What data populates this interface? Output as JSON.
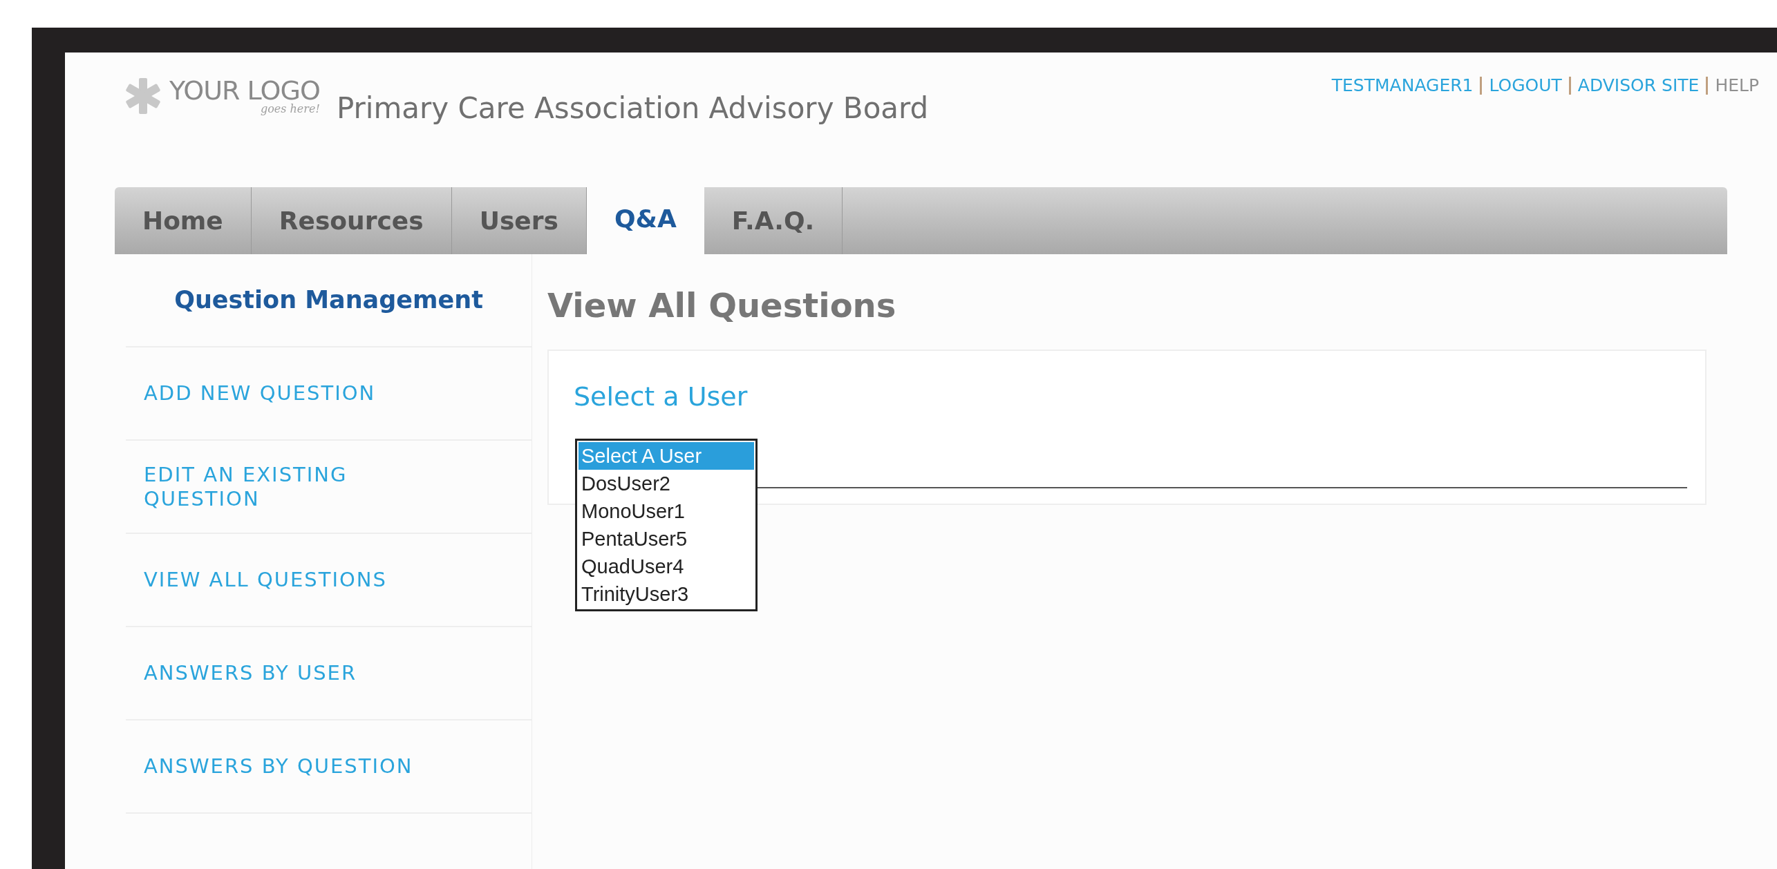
{
  "header": {
    "logo": {
      "main": "YOUR LOGO",
      "sub": "goes here!"
    },
    "site_title": "Primary Care Association Advisory Board",
    "top_links": [
      {
        "label": "TESTMANAGER1",
        "kind": "link"
      },
      {
        "label": "LOGOUT",
        "kind": "link"
      },
      {
        "label": "ADVISOR SITE",
        "kind": "link"
      },
      {
        "label": "HELP",
        "kind": "muted"
      }
    ]
  },
  "tabs": [
    {
      "label": "Home",
      "selected": false
    },
    {
      "label": "Resources",
      "selected": false
    },
    {
      "label": "Users",
      "selected": false
    },
    {
      "label": "Q&A",
      "selected": true
    },
    {
      "label": "F.A.Q.",
      "selected": false
    }
  ],
  "sidebar": {
    "title": "Question Management",
    "items": [
      "ADD NEW QUESTION",
      "EDIT AN EXISTING QUESTION",
      "VIEW ALL QUESTIONS",
      "ANSWERS BY USER",
      "ANSWERS BY QUESTION"
    ]
  },
  "main": {
    "heading": "View All Questions",
    "card_title": "Select a User",
    "user_list": [
      {
        "label": "Select A User",
        "selected": true
      },
      {
        "label": "DosUser2",
        "selected": false
      },
      {
        "label": "MonoUser1",
        "selected": false
      },
      {
        "label": "PentaUser5",
        "selected": false
      },
      {
        "label": "QuadUser4",
        "selected": false
      },
      {
        "label": "TrinityUser3",
        "selected": false
      }
    ]
  }
}
